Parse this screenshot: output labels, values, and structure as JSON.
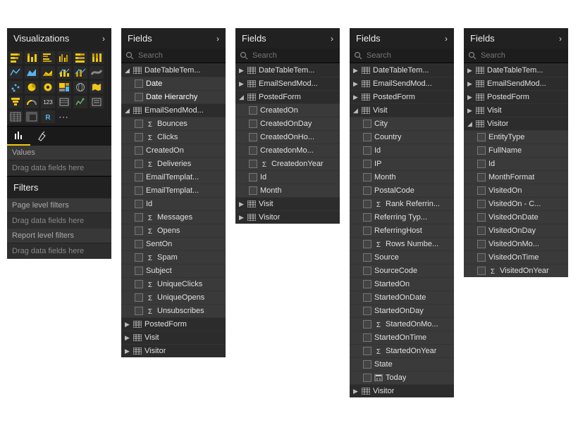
{
  "visualizations": {
    "header": "Visualizations",
    "values_label": "Values",
    "drag_here": "Drag data fields here",
    "filters_header": "Filters",
    "page_filters": "Page level filters",
    "report_filters": "Report level filters"
  },
  "search_placeholder": "Search",
  "fields_header": "Fields",
  "panels": [
    {
      "tree": [
        {
          "d": 1,
          "expand": "open",
          "icon": "table",
          "label": "DateTableTem..."
        },
        {
          "d": 2,
          "expand": "none",
          "icon": "",
          "label": "Date",
          "selected": true
        },
        {
          "d": 2,
          "expand": "none",
          "icon": "",
          "label": "Date Hierarchy",
          "selected": true
        },
        {
          "d": 1,
          "expand": "open",
          "icon": "table",
          "label": "EmailSendMod..."
        },
        {
          "d": 2,
          "expand": "none",
          "icon": "sigma",
          "label": "Bounces"
        },
        {
          "d": 2,
          "expand": "none",
          "icon": "sigma",
          "label": "Clicks"
        },
        {
          "d": 2,
          "expand": "none",
          "icon": "",
          "label": "CreatedOn"
        },
        {
          "d": 2,
          "expand": "none",
          "icon": "sigma",
          "label": "Deliveries"
        },
        {
          "d": 2,
          "expand": "none",
          "icon": "",
          "label": "EmailTemplat..."
        },
        {
          "d": 2,
          "expand": "none",
          "icon": "",
          "label": "EmailTemplat..."
        },
        {
          "d": 2,
          "expand": "none",
          "icon": "",
          "label": "Id"
        },
        {
          "d": 2,
          "expand": "none",
          "icon": "sigma",
          "label": "Messages"
        },
        {
          "d": 2,
          "expand": "none",
          "icon": "sigma",
          "label": "Opens"
        },
        {
          "d": 2,
          "expand": "none",
          "icon": "",
          "label": "SentOn"
        },
        {
          "d": 2,
          "expand": "none",
          "icon": "sigma",
          "label": "Spam"
        },
        {
          "d": 2,
          "expand": "none",
          "icon": "",
          "label": "Subject"
        },
        {
          "d": 2,
          "expand": "none",
          "icon": "sigma",
          "label": "UniqueClicks"
        },
        {
          "d": 2,
          "expand": "none",
          "icon": "sigma",
          "label": "UniqueOpens"
        },
        {
          "d": 2,
          "expand": "none",
          "icon": "sigma",
          "label": "Unsubscribes"
        },
        {
          "d": 1,
          "expand": "closed",
          "icon": "table",
          "label": "PostedForm"
        },
        {
          "d": 1,
          "expand": "closed",
          "icon": "table",
          "label": "Visit"
        },
        {
          "d": 1,
          "expand": "closed",
          "icon": "table",
          "label": "Visitor"
        }
      ]
    },
    {
      "tree": [
        {
          "d": 1,
          "expand": "closed",
          "icon": "table",
          "label": "DateTableTem..."
        },
        {
          "d": 1,
          "expand": "closed",
          "icon": "table",
          "label": "EmailSendMod..."
        },
        {
          "d": 1,
          "expand": "open",
          "icon": "table",
          "label": "PostedForm"
        },
        {
          "d": 2,
          "expand": "none",
          "icon": "",
          "label": "CreatedOn"
        },
        {
          "d": 2,
          "expand": "none",
          "icon": "",
          "label": "CreatedOnDay"
        },
        {
          "d": 2,
          "expand": "none",
          "icon": "",
          "label": "CreatedOnHo..."
        },
        {
          "d": 2,
          "expand": "none",
          "icon": "",
          "label": "CreatedonMo..."
        },
        {
          "d": 2,
          "expand": "none",
          "icon": "sigma",
          "label": "CreatedonYear"
        },
        {
          "d": 2,
          "expand": "none",
          "icon": "",
          "label": "Id"
        },
        {
          "d": 2,
          "expand": "none",
          "icon": "",
          "label": "Month"
        },
        {
          "d": 1,
          "expand": "closed",
          "icon": "table",
          "label": "Visit"
        },
        {
          "d": 1,
          "expand": "closed",
          "icon": "table",
          "label": "Visitor"
        }
      ]
    },
    {
      "tree": [
        {
          "d": 1,
          "expand": "closed",
          "icon": "table",
          "label": "DateTableTem..."
        },
        {
          "d": 1,
          "expand": "closed",
          "icon": "table",
          "label": "EmailSendMod..."
        },
        {
          "d": 1,
          "expand": "closed",
          "icon": "table",
          "label": "PostedForm"
        },
        {
          "d": 1,
          "expand": "open",
          "icon": "table",
          "label": "Visit"
        },
        {
          "d": 2,
          "expand": "none",
          "icon": "",
          "label": "City"
        },
        {
          "d": 2,
          "expand": "none",
          "icon": "",
          "label": "Country"
        },
        {
          "d": 2,
          "expand": "none",
          "icon": "",
          "label": "Id"
        },
        {
          "d": 2,
          "expand": "none",
          "icon": "",
          "label": "IP"
        },
        {
          "d": 2,
          "expand": "none",
          "icon": "",
          "label": "Month"
        },
        {
          "d": 2,
          "expand": "none",
          "icon": "",
          "label": "PostalCode"
        },
        {
          "d": 2,
          "expand": "none",
          "icon": "sigma",
          "label": "Rank Referrin..."
        },
        {
          "d": 2,
          "expand": "none",
          "icon": "",
          "label": "Referring Typ..."
        },
        {
          "d": 2,
          "expand": "none",
          "icon": "",
          "label": "ReferringHost"
        },
        {
          "d": 2,
          "expand": "none",
          "icon": "sigma",
          "label": "Rows Numbe..."
        },
        {
          "d": 2,
          "expand": "none",
          "icon": "",
          "label": "Source"
        },
        {
          "d": 2,
          "expand": "none",
          "icon": "",
          "label": "SourceCode"
        },
        {
          "d": 2,
          "expand": "none",
          "icon": "",
          "label": "StartedOn"
        },
        {
          "d": 2,
          "expand": "none",
          "icon": "",
          "label": "StartedOnDate"
        },
        {
          "d": 2,
          "expand": "none",
          "icon": "",
          "label": "StartedOnDay"
        },
        {
          "d": 2,
          "expand": "none",
          "icon": "sigma",
          "label": "StartedOnMo..."
        },
        {
          "d": 2,
          "expand": "none",
          "icon": "",
          "label": "StartedOnTime"
        },
        {
          "d": 2,
          "expand": "none",
          "icon": "sigma",
          "label": "StartedOnYear"
        },
        {
          "d": 2,
          "expand": "none",
          "icon": "",
          "label": "State"
        },
        {
          "d": 2,
          "expand": "none",
          "icon": "calc",
          "label": "Today"
        },
        {
          "d": 1,
          "expand": "closed",
          "icon": "table",
          "label": "Visitor"
        }
      ]
    },
    {
      "tree": [
        {
          "d": 1,
          "expand": "closed",
          "icon": "table",
          "label": "DateTableTem..."
        },
        {
          "d": 1,
          "expand": "closed",
          "icon": "table",
          "label": "EmailSendMod..."
        },
        {
          "d": 1,
          "expand": "closed",
          "icon": "table",
          "label": "PostedForm"
        },
        {
          "d": 1,
          "expand": "closed",
          "icon": "table",
          "label": "Visit"
        },
        {
          "d": 1,
          "expand": "open",
          "icon": "table",
          "label": "Visitor"
        },
        {
          "d": 2,
          "expand": "none",
          "icon": "",
          "label": "EntityType"
        },
        {
          "d": 2,
          "expand": "none",
          "icon": "",
          "label": "FullName"
        },
        {
          "d": 2,
          "expand": "none",
          "icon": "",
          "label": "Id"
        },
        {
          "d": 2,
          "expand": "none",
          "icon": "",
          "label": "MonthFormat"
        },
        {
          "d": 2,
          "expand": "none",
          "icon": "",
          "label": "VisitedOn"
        },
        {
          "d": 2,
          "expand": "none",
          "icon": "",
          "label": "VisitedOn - C..."
        },
        {
          "d": 2,
          "expand": "none",
          "icon": "",
          "label": "VisitedOnDate"
        },
        {
          "d": 2,
          "expand": "none",
          "icon": "",
          "label": "VisitedOnDay"
        },
        {
          "d": 2,
          "expand": "none",
          "icon": "",
          "label": "VisitedOnMo..."
        },
        {
          "d": 2,
          "expand": "none",
          "icon": "",
          "label": "VisitedOnTime"
        },
        {
          "d": 2,
          "expand": "none",
          "icon": "sigma",
          "label": "VisitedOnYear"
        }
      ]
    }
  ]
}
